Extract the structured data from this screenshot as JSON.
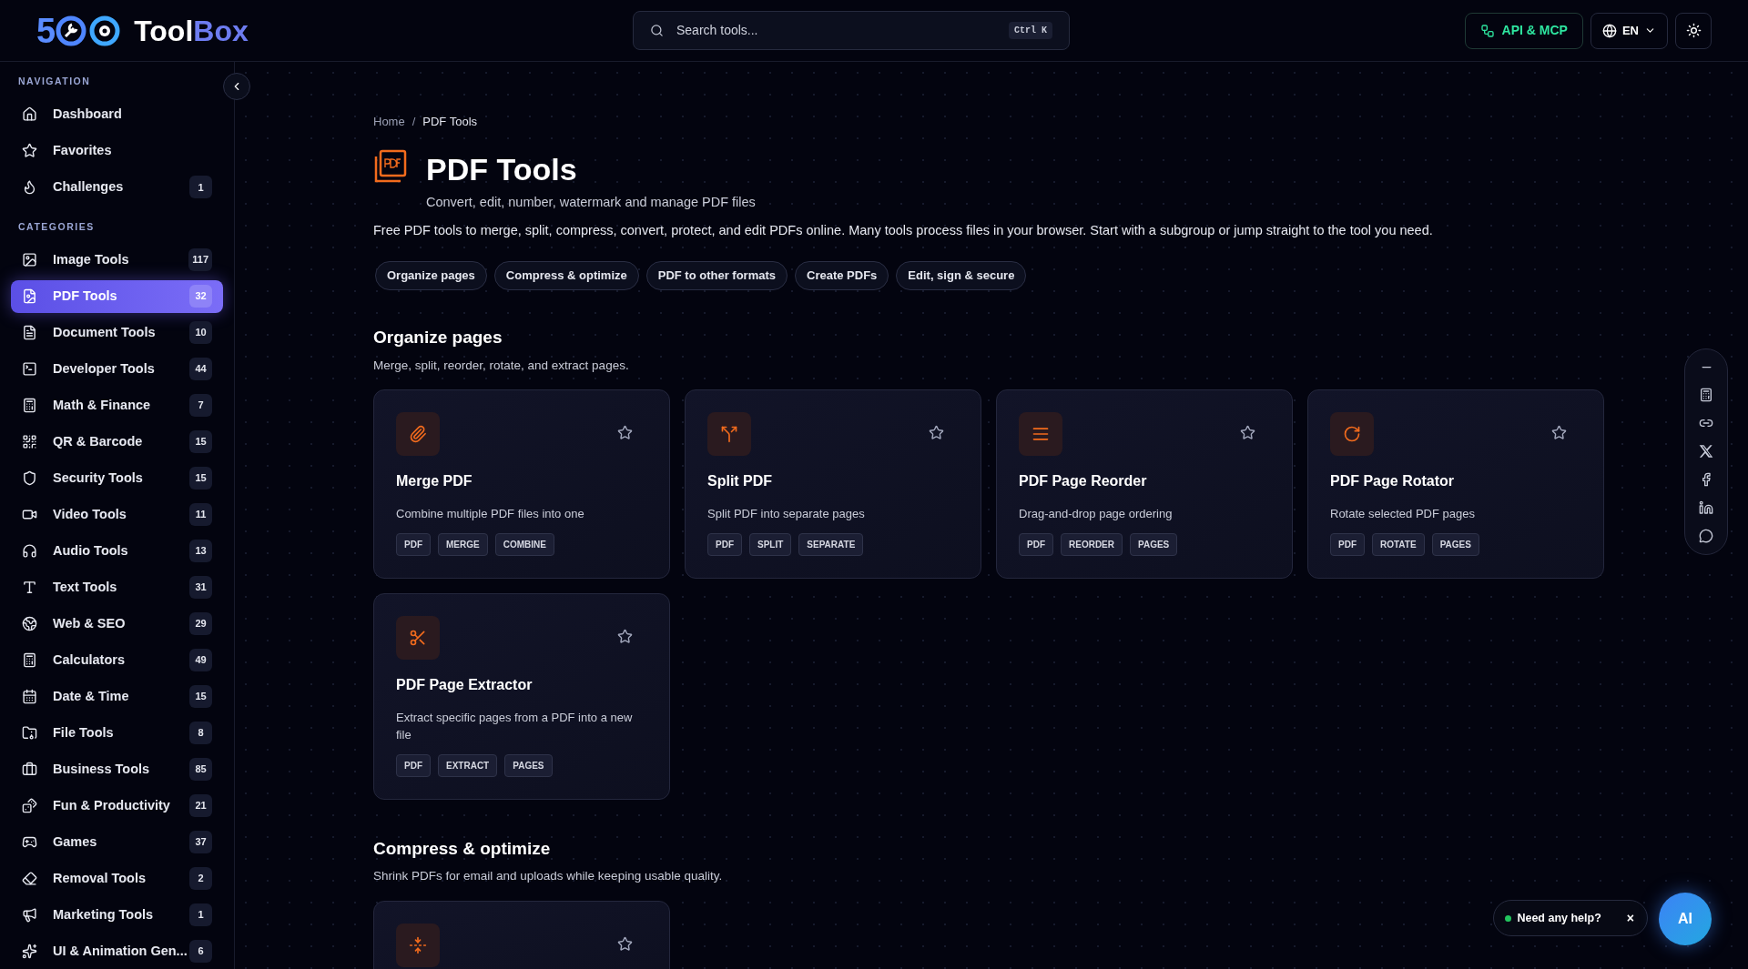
{
  "header": {
    "logo": {
      "digit": "5",
      "word_light": "Tool",
      "word_accent": "Box"
    },
    "search": {
      "placeholder": "Search tools...",
      "shortcut": "Ctrl K"
    },
    "api_button": "API & MCP",
    "language": "EN"
  },
  "sidebar": {
    "sections": [
      {
        "title": "NAVIGATION",
        "items": [
          {
            "label": "Dashboard",
            "selected": false
          },
          {
            "label": "Favorites",
            "selected": false
          },
          {
            "label": "Challenges",
            "count": "1",
            "selected": false
          }
        ]
      },
      {
        "title": "CATEGORIES",
        "items": [
          {
            "label": "Image Tools",
            "count": "117",
            "selected": false
          },
          {
            "label": "PDF Tools",
            "count": "32",
            "selected": true
          },
          {
            "label": "Document Tools",
            "count": "10",
            "selected": false
          },
          {
            "label": "Developer Tools",
            "count": "44",
            "selected": false
          },
          {
            "label": "Math & Finance",
            "count": "7",
            "selected": false
          },
          {
            "label": "QR & Barcode",
            "count": "15",
            "selected": false
          },
          {
            "label": "Security Tools",
            "count": "15",
            "selected": false
          },
          {
            "label": "Video Tools",
            "count": "11",
            "selected": false
          },
          {
            "label": "Audio Tools",
            "count": "13",
            "selected": false
          },
          {
            "label": "Text Tools",
            "count": "31",
            "selected": false
          },
          {
            "label": "Web & SEO",
            "count": "29",
            "selected": false
          },
          {
            "label": "Calculators",
            "count": "49",
            "selected": false
          },
          {
            "label": "Date & Time",
            "count": "15",
            "selected": false
          },
          {
            "label": "File Tools",
            "count": "8",
            "selected": false
          },
          {
            "label": "Business Tools",
            "count": "85",
            "selected": false
          },
          {
            "label": "Fun & Productivity",
            "count": "21",
            "selected": false
          },
          {
            "label": "Games",
            "count": "37",
            "selected": false
          },
          {
            "label": "Removal Tools",
            "count": "2",
            "selected": false
          },
          {
            "label": "Marketing Tools",
            "count": "1",
            "selected": false
          },
          {
            "label": "UI & Animation Gen...",
            "count": "6",
            "selected": false
          }
        ]
      }
    ]
  },
  "breadcrumb": {
    "separator": "/",
    "items": [
      "Home",
      "PDF Tools"
    ]
  },
  "page": {
    "title": "PDF Tools",
    "subtitle": "Convert, edit, number, watermark and manage PDF files",
    "intro": "Free PDF tools to merge, split, compress, convert, protect, and edit PDFs online. Many tools process files in your browser. Start with a subgroup or jump straight to the tool you need."
  },
  "subgroups": [
    "Organize pages",
    "Compress & optimize",
    "PDF to other formats",
    "Create PDFs",
    "Edit, sign & secure"
  ],
  "sections": [
    {
      "title": "Organize pages",
      "description": "Merge, split, reorder, rotate, and extract pages.",
      "tools": [
        {
          "name": "Merge PDF",
          "description": "Combine multiple PDF files into one",
          "tags": [
            "PDF",
            "MERGE",
            "COMBINE"
          ],
          "favorite": false
        },
        {
          "name": "Split PDF",
          "description": "Split PDF into separate pages",
          "tags": [
            "PDF",
            "SPLIT",
            "SEPARATE"
          ],
          "favorite": false
        },
        {
          "name": "PDF Page Reorder",
          "description": "Drag-and-drop page ordering",
          "tags": [
            "PDF",
            "REORDER",
            "PAGES"
          ],
          "favorite": false
        },
        {
          "name": "PDF Page Rotator",
          "description": "Rotate selected PDF pages",
          "tags": [
            "PDF",
            "ROTATE",
            "PAGES"
          ],
          "favorite": false
        },
        {
          "name": "PDF Page Extractor",
          "description": "Extract specific pages from a PDF into a new file",
          "tags": [
            "PDF",
            "EXTRACT",
            "PAGES"
          ],
          "favorite": false
        }
      ]
    },
    {
      "title": "Compress & optimize",
      "description": "Shrink PDFs for email and uploads while keeping usable quality.",
      "tools": [
        {
          "favorite": false
        }
      ]
    }
  ],
  "help": {
    "text": "Need any help?",
    "close": "×",
    "ai": "AI"
  }
}
